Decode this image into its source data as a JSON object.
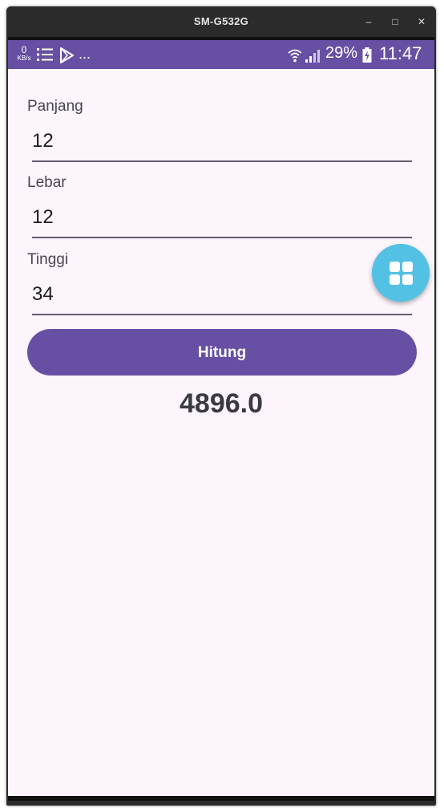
{
  "window": {
    "title": "SM-G532G",
    "minimize_glyph": "–",
    "maximize_glyph": "□",
    "close_glyph": "✕"
  },
  "status_bar": {
    "speed_value": "0",
    "speed_unit": "KB/s",
    "more": "...",
    "battery_percent": "29%",
    "time": "11:47",
    "icons": [
      "list-icon",
      "play-store-icon",
      "wifi-icon",
      "signal-icon",
      "battery-charging-icon"
    ]
  },
  "form": {
    "panjang": {
      "label": "Panjang",
      "value": "12"
    },
    "lebar": {
      "label": "Lebar",
      "value": "12"
    },
    "tinggi": {
      "label": "Tinggi",
      "value": "34"
    },
    "button_label": "Hitung",
    "result": "4896.0"
  },
  "fab": {
    "icon": "grid-icon"
  },
  "colors": {
    "primary": "#6750a4",
    "background": "#fcf5fb",
    "fab": "#53c1e3",
    "underline": "#625b71"
  }
}
